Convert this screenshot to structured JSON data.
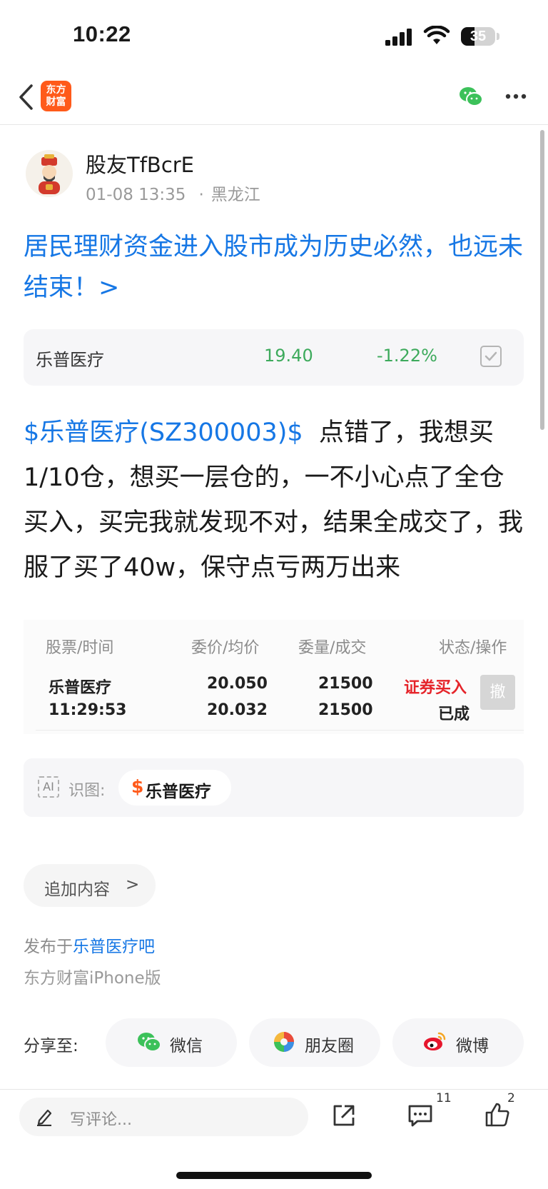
{
  "status_bar": {
    "time": "10:22",
    "battery": "35"
  },
  "nav": {
    "logo_line1": "东方",
    "logo_line2": "财富"
  },
  "author": {
    "name": "股友TfBcrE",
    "date": "01-08 13:35",
    "dot": "·",
    "location": "黑龙江"
  },
  "post": {
    "title": "居民理财资金进入股市成为历史必然，也远未结束！>",
    "stock_link": "$乐普医疗(SZ300003)$",
    "body": "点错了，我想买1/10仓，想买一层仓的，一不小心点了全仓买入，买完我就发现不对，结果全成交了，我服了买了40w，保守点亏两万出来"
  },
  "quote": {
    "name": "乐普医疗",
    "price": "19.40",
    "change": "-1.22%"
  },
  "order": {
    "headers": [
      "股票/时间",
      "委价/均价",
      "委量/成交",
      "状态/操作"
    ],
    "stock": "乐普医疗",
    "time": "11:29:53",
    "order_price": "20.050",
    "avg_price": "20.032",
    "order_qty": "21500",
    "filled_qty": "21500",
    "status": "证券买入",
    "result": "已成",
    "cancel": "撤"
  },
  "ai": {
    "label": "识图:",
    "icon_text": "AI",
    "chip_symbol": "$",
    "chip_name": "乐普医疗"
  },
  "append": {
    "label": "追加内容",
    "chevron": ">"
  },
  "footer": {
    "posted_prefix": "发布于",
    "forum": "乐普医疗吧",
    "client": "东方财富iPhone版"
  },
  "share": {
    "label": "分享至:",
    "wechat": "微信",
    "moments": "朋友圈",
    "weibo": "微博"
  },
  "bottom_bar": {
    "comment_placeholder": "写评论...",
    "comment_count": "11",
    "like_count": "2"
  },
  "colors": {
    "brand_orange": "#ff5a1a",
    "link_blue": "#1677e5",
    "down_green": "#3daa5c",
    "buy_red": "#e5242a"
  }
}
